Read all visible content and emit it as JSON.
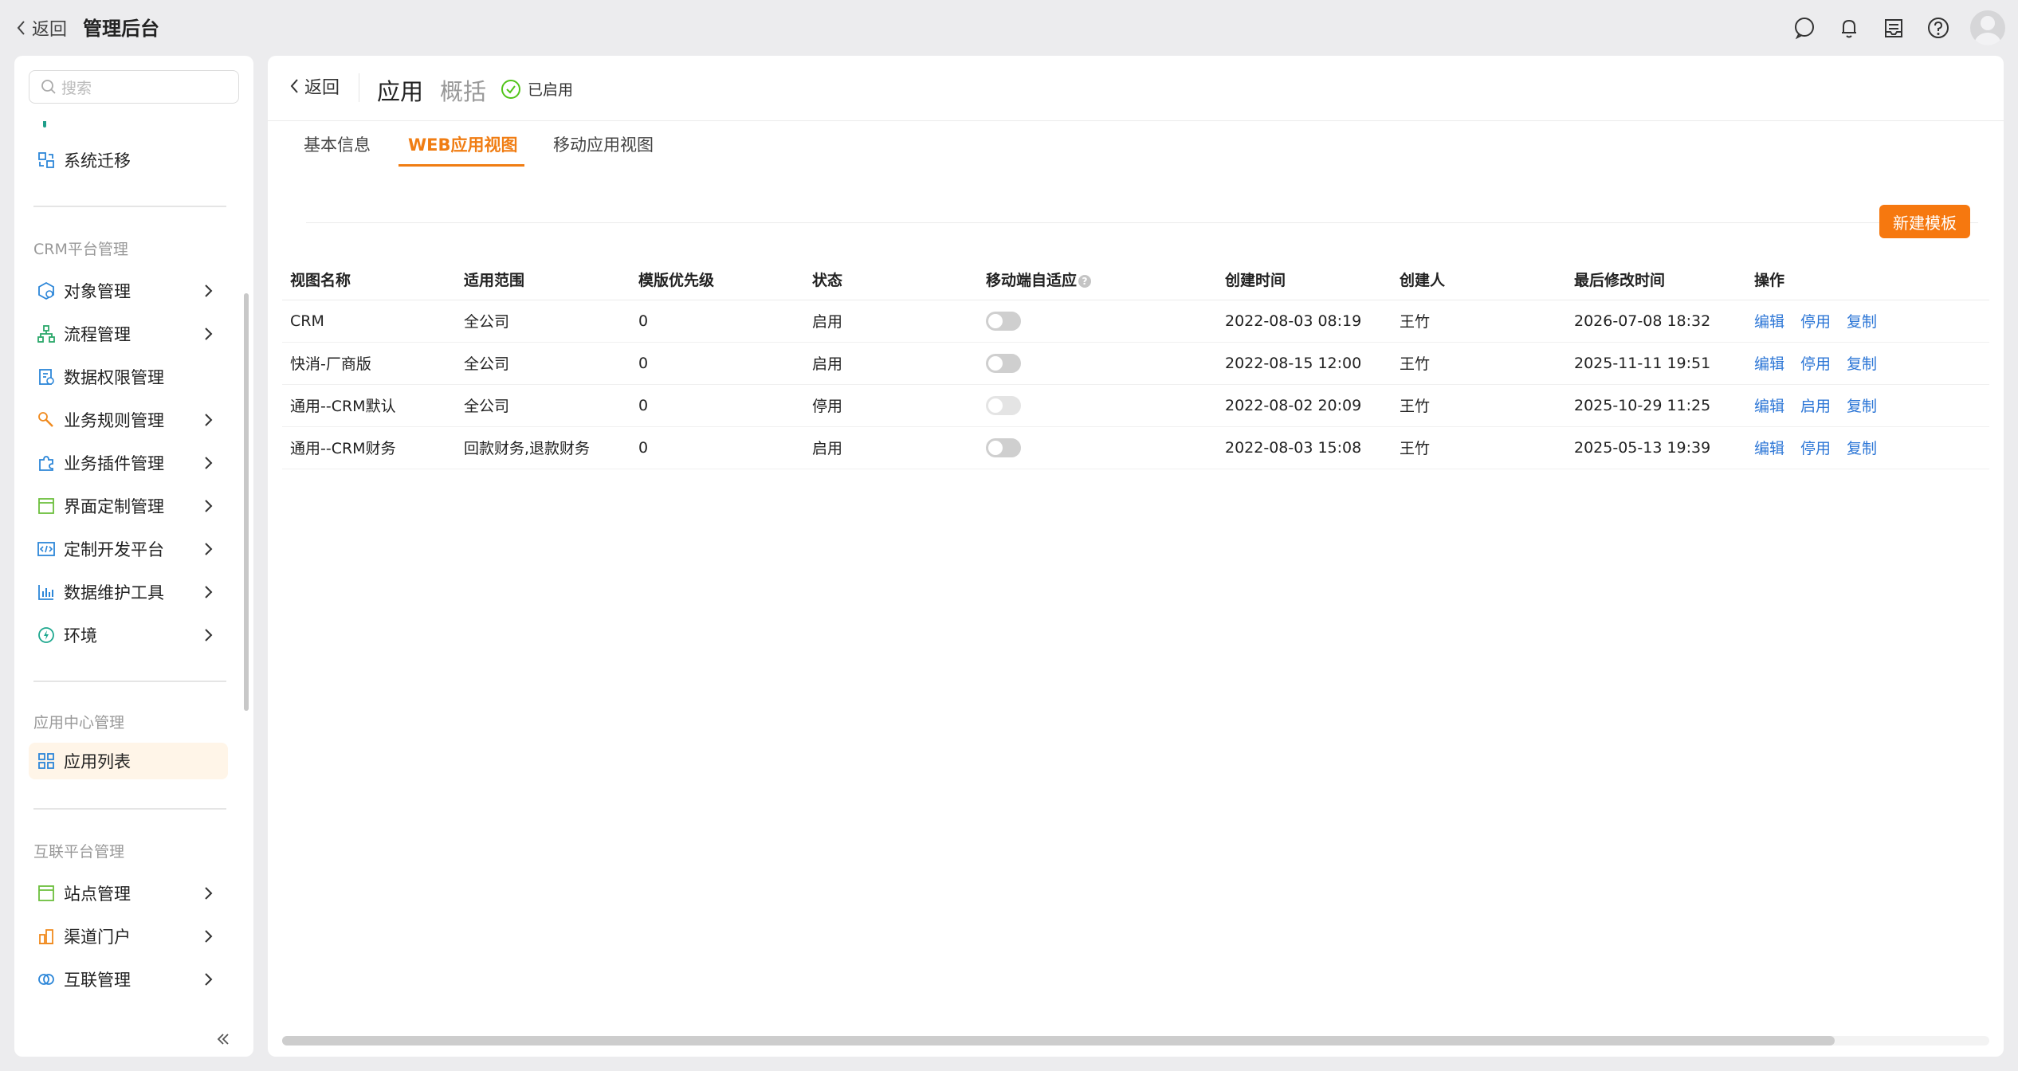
{
  "topbar": {
    "back_label": "返回",
    "title": "管理后台",
    "icons": [
      "message-icon",
      "bell-icon",
      "inbox-icon",
      "help-icon",
      "avatar"
    ]
  },
  "sidebar": {
    "search_placeholder": "搜索",
    "items_top": [
      {
        "label": "系统迁移",
        "icon": "migrate-icon"
      }
    ],
    "groups": [
      {
        "title": "CRM平台管理",
        "items": [
          {
            "label": "对象管理",
            "icon": "object-icon",
            "expandable": true
          },
          {
            "label": "流程管理",
            "icon": "flow-icon",
            "expandable": true
          },
          {
            "label": "数据权限管理",
            "icon": "data-permission-icon",
            "expandable": false
          },
          {
            "label": "业务规则管理",
            "icon": "wrench-icon",
            "expandable": true
          },
          {
            "label": "业务插件管理",
            "icon": "puzzle-icon",
            "expandable": true
          },
          {
            "label": "界面定制管理",
            "icon": "layout-icon",
            "expandable": true
          },
          {
            "label": "定制开发平台",
            "icon": "code-icon",
            "expandable": true
          },
          {
            "label": "数据维护工具",
            "icon": "bar-chart-icon",
            "expandable": true
          },
          {
            "label": "环境",
            "icon": "environment-icon",
            "expandable": true
          }
        ]
      },
      {
        "title": "应用中心管理",
        "items": [
          {
            "label": "应用列表",
            "icon": "grid-icon",
            "expandable": false,
            "active": true
          }
        ]
      },
      {
        "title": "互联平台管理",
        "items": [
          {
            "label": "站点管理",
            "icon": "site-icon",
            "expandable": true
          },
          {
            "label": "渠道门户",
            "icon": "channel-icon",
            "expandable": true
          },
          {
            "label": "互联管理",
            "icon": "link-icon",
            "expandable": true
          }
        ]
      }
    ]
  },
  "main": {
    "back_label": "返回",
    "title": "应用",
    "subtitle": "概括",
    "status": "已启用",
    "tabs": [
      "基本信息",
      "WEB应用视图",
      "移动应用视图"
    ],
    "active_tab": 1,
    "new_button": "新建模板",
    "table": {
      "headers": [
        "视图名称",
        "适用范围",
        "模版优先级",
        "状态",
        "移动端自适应",
        "创建时间",
        "创建人",
        "最后修改时间",
        "操作"
      ],
      "rows": [
        {
          "name": "CRM",
          "scope": "全公司",
          "priority": "0",
          "status": "启用",
          "toggle": "off",
          "created": "2022-08-03 08:19",
          "creator": "王竹",
          "modified": "2026-07-08 18:32",
          "ops": [
            "编辑",
            "停用",
            "复制"
          ]
        },
        {
          "name": "快消-厂商版",
          "scope": "全公司",
          "priority": "0",
          "status": "启用",
          "toggle": "off",
          "created": "2022-08-15 12:00",
          "creator": "王竹",
          "modified": "2025-11-11 19:51",
          "ops": [
            "编辑",
            "停用",
            "复制"
          ]
        },
        {
          "name": "通用--CRM默认",
          "scope": "全公司",
          "priority": "0",
          "status": "停用",
          "toggle": "disabled",
          "created": "2022-08-02 20:09",
          "creator": "王竹",
          "modified": "2025-10-29 11:25",
          "ops": [
            "编辑",
            "启用",
            "复制"
          ]
        },
        {
          "name": "通用--CRM财务",
          "scope": "回款财务,退款财务",
          "priority": "0",
          "status": "启用",
          "toggle": "off",
          "created": "2022-08-03 15:08",
          "creator": "王竹",
          "modified": "2025-05-13 19:39",
          "ops": [
            "编辑",
            "停用",
            "复制"
          ]
        }
      ]
    }
  },
  "colors": {
    "accent": "#f07d13",
    "link": "#2c76d6",
    "active_bg": "#fff5e8",
    "success": "#52c41a"
  }
}
